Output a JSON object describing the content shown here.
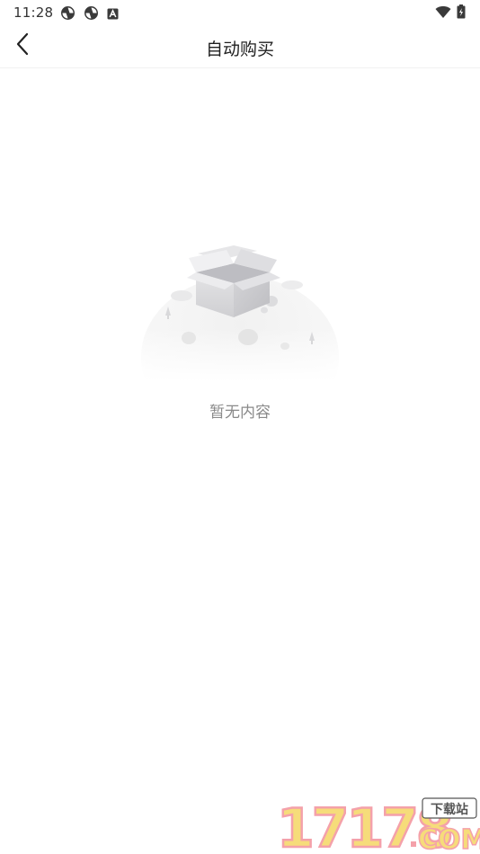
{
  "status_bar": {
    "time": "11:28",
    "left_icons": [
      "sync-icon",
      "sync-icon",
      "a-app-icon"
    ],
    "right_icons": [
      "wifi-icon",
      "battery-icon"
    ]
  },
  "header": {
    "title": "自动购买",
    "back_icon": "chevron-left-icon"
  },
  "empty_state": {
    "illustration": "empty-box-illustration",
    "message": "暂无内容"
  },
  "watermark": {
    "number": "17178",
    "domain": "COM",
    "tag": "下载站"
  },
  "colors": {
    "background": "#ffffff",
    "title_text": "#1f1f1f",
    "empty_text": "#8a8a8a",
    "watermark_yellow": "#f6dc7a",
    "watermark_pink": "#f4a1aa"
  }
}
